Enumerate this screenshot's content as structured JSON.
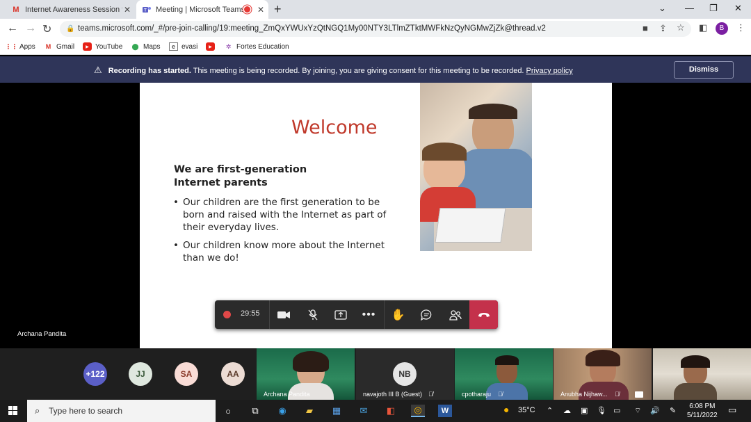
{
  "browser": {
    "tabs": [
      {
        "title": "Internet Awareness Session for P",
        "icon": "gmail-icon"
      },
      {
        "title": "Meeting | Microsoft Teams",
        "icon": "teams-icon",
        "recording": true
      }
    ],
    "url": "teams.microsoft.com/_#/pre-join-calling/19:meeting_ZmQxYWUxYzQtNGQ1My00NTY3LTlmZTktMWFkNzQyNGMwZjZk@thread.v2",
    "profile_initial": "B",
    "bookmarks": [
      "Apps",
      "Gmail",
      "YouTube",
      "Maps",
      "evasi",
      "",
      "Fortes Education"
    ]
  },
  "banner": {
    "bold": "Recording has started.",
    "text": " This meeting is being recorded. By joining, you are giving consent for this meeting to be recorded. ",
    "link": "Privacy policy",
    "dismiss": "Dismiss"
  },
  "slide": {
    "title": "Welcome",
    "subtitle_line1": "We are first-generation",
    "subtitle_line2": "Internet parents",
    "bullets": [
      "Our children are the first generation to be born and raised with the Internet as part of their everyday lives.",
      "Our children know more about the Internet than we do!"
    ]
  },
  "presenter_caption": "Archana Pandita",
  "call_controls": {
    "timer": "29:55"
  },
  "participants": {
    "overflow": "+122",
    "avatars": [
      {
        "initials": "JJ",
        "bg": "#dfe8df",
        "fg": "#3b5a3b"
      },
      {
        "initials": "SA",
        "bg": "#f9dcd6",
        "fg": "#8a3a2a"
      },
      {
        "initials": "AA",
        "bg": "#ecdcd4",
        "fg": "#5a3a2a"
      }
    ],
    "tiles": [
      {
        "name": "Archana Pandita"
      },
      {
        "name": "navajoth III B (Guest)",
        "initials": "NB"
      },
      {
        "name": "cpotharaju"
      },
      {
        "name": "Anubha Nijhaw..."
      },
      {
        "name": ""
      }
    ]
  },
  "taskbar": {
    "search_placeholder": "Type here to search",
    "weather": "35°C",
    "time": "6:08 PM",
    "date": "5/11/2022"
  }
}
